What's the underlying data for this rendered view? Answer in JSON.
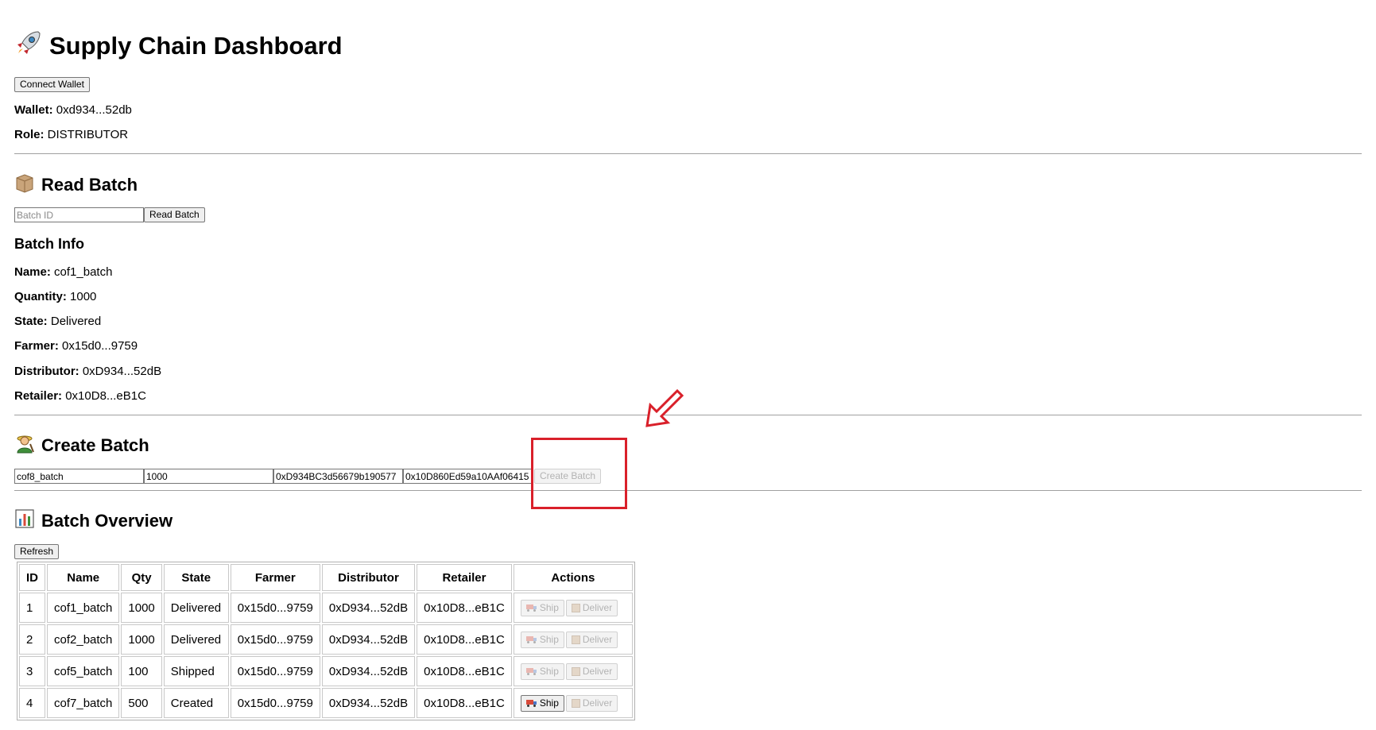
{
  "header": {
    "title": "Supply Chain Dashboard",
    "icon": "rocket-icon",
    "connect_label": "Connect Wallet",
    "wallet_label": "Wallet:",
    "wallet_value": "0xd934...52db",
    "role_label": "Role:",
    "role_value": "DISTRIBUTOR"
  },
  "read_batch": {
    "title": "Read Batch",
    "icon": "package-icon",
    "placeholder": "Batch ID",
    "button_label": "Read Batch",
    "info_title": "Batch Info",
    "fields": [
      {
        "label": "Name:",
        "value": "cof1_batch"
      },
      {
        "label": "Quantity:",
        "value": "1000"
      },
      {
        "label": "State:",
        "value": "Delivered"
      },
      {
        "label": "Farmer:",
        "value": "0x15d0...9759"
      },
      {
        "label": "Distributor:",
        "value": "0xD934...52dB"
      },
      {
        "label": "Retailer:",
        "value": "0x10D8...eB1C"
      }
    ]
  },
  "create_batch": {
    "title": "Create Batch",
    "icon": "farmer-icon",
    "name_value": "cof8_batch",
    "qty_value": "1000",
    "distributor_value": "0xD934BC3d56679b190577",
    "retailer_value": "0x10D860Ed59a10AAf06415",
    "button_label": "Create Batch"
  },
  "overview": {
    "title": "Batch Overview",
    "icon": "bar-chart-icon",
    "refresh_label": "Refresh",
    "columns": [
      "ID",
      "Name",
      "Qty",
      "State",
      "Farmer",
      "Distributor",
      "Retailer",
      "Actions"
    ],
    "ship_label": "Ship",
    "deliver_label": "Deliver",
    "rows": [
      {
        "id": "1",
        "name": "cof1_batch",
        "qty": "1000",
        "state": "Delivered",
        "farmer": "0x15d0...9759",
        "distributor": "0xD934...52dB",
        "retailer": "0x10D8...eB1C"
      },
      {
        "id": "2",
        "name": "cof2_batch",
        "qty": "1000",
        "state": "Delivered",
        "farmer": "0x15d0...9759",
        "distributor": "0xD934...52dB",
        "retailer": "0x10D8...eB1C"
      },
      {
        "id": "3",
        "name": "cof5_batch",
        "qty": "100",
        "state": "Shipped",
        "farmer": "0x15d0...9759",
        "distributor": "0xD934...52dB",
        "retailer": "0x10D8...eB1C"
      },
      {
        "id": "4",
        "name": "cof7_batch",
        "qty": "500",
        "state": "Created",
        "farmer": "0x15d0...9759",
        "distributor": "0xD934...52dB",
        "retailer": "0x10D8...eB1C"
      }
    ]
  },
  "colors": {
    "highlight": "#d9202a"
  }
}
